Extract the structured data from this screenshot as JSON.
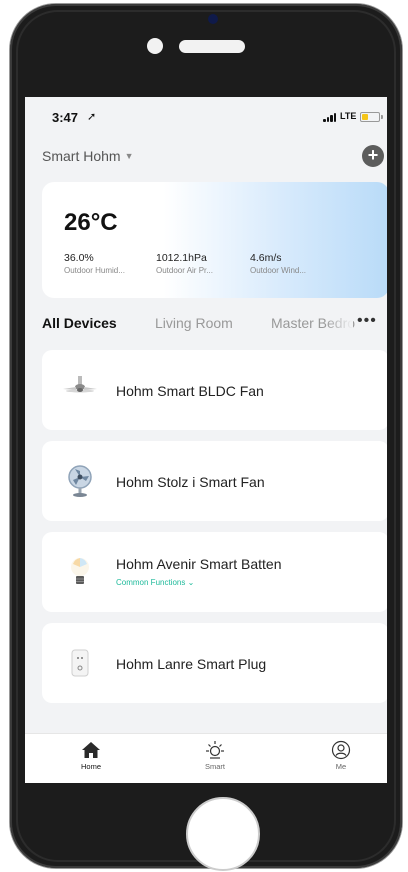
{
  "status_bar": {
    "time": "3:47",
    "network": "LTE"
  },
  "header": {
    "home_name": "Smart Hohm"
  },
  "weather": {
    "temperature": "26°C",
    "stats": [
      {
        "value": "36.0%",
        "label": "Outdoor Humid..."
      },
      {
        "value": "1012.1hPa",
        "label": "Outdoor Air Pr..."
      },
      {
        "value": "4.6m/s",
        "label": "Outdoor Wind..."
      }
    ]
  },
  "rooms": {
    "tabs": [
      "All Devices",
      "Living Room",
      "Master Bedro"
    ],
    "active": "All Devices"
  },
  "devices": [
    {
      "name": "Hohm Smart BLDC Fan",
      "icon": "ceiling-fan-icon"
    },
    {
      "name": "Hohm Stolz i Smart Fan",
      "icon": "table-fan-icon"
    },
    {
      "name": "Hohm Avenir Smart Batten",
      "icon": "bulb-icon",
      "sub": "Common Functions"
    },
    {
      "name": "Hohm Lanre Smart Plug",
      "icon": "smart-plug-icon"
    }
  ],
  "tab_bar": {
    "items": [
      {
        "label": "Home",
        "icon": "home-icon"
      },
      {
        "label": "Smart",
        "icon": "sun-icon"
      },
      {
        "label": "Me",
        "icon": "user-icon"
      }
    ]
  },
  "colors": {
    "accent": "#1fba9b",
    "battery": "#f5c518",
    "card_gradient_end": "#b9dbf8"
  },
  "battery_level": 0.4
}
